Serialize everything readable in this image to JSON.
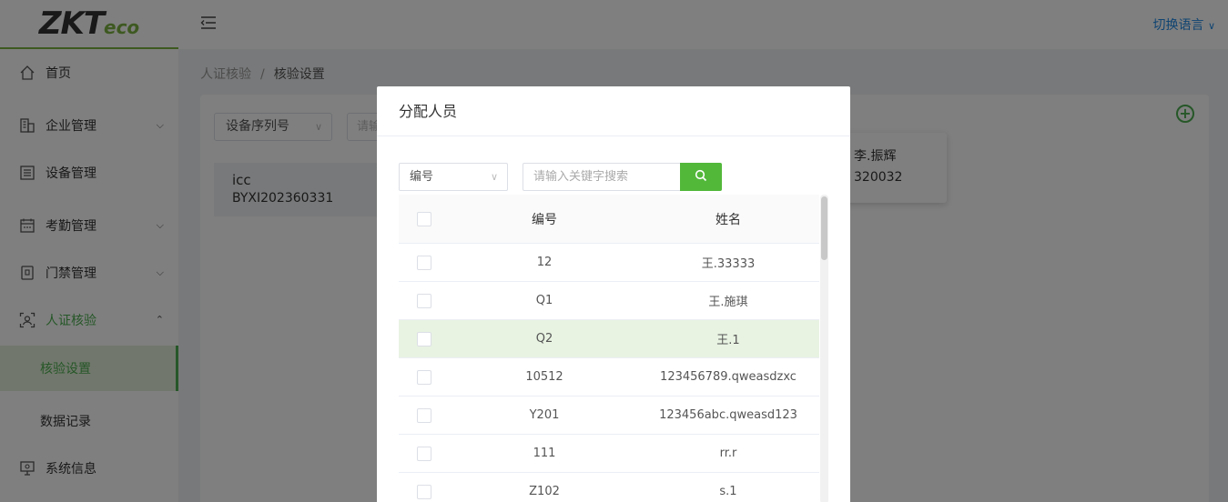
{
  "logo": {
    "main": "ZKT",
    "sub": "eco"
  },
  "header": {
    "language": "切换语言"
  },
  "sidebar": {
    "items": [
      {
        "label": "首页",
        "icon": "home-icon"
      },
      {
        "label": "企业管理",
        "icon": "building-icon"
      },
      {
        "label": "设备管理",
        "icon": "device-icon"
      },
      {
        "label": "考勤管理",
        "icon": "calendar-icon"
      },
      {
        "label": "门禁管理",
        "icon": "door-icon"
      },
      {
        "label": "人证核验",
        "icon": "face-scan-icon"
      },
      {
        "label": "系统信息",
        "icon": "monitor-icon"
      }
    ],
    "submenu": [
      {
        "label": "核验设置"
      },
      {
        "label": "数据记录"
      }
    ]
  },
  "breadcrumb": {
    "parent": "人证核验",
    "separator": "/",
    "current": "核验设置"
  },
  "filters": {
    "serial_select": "设备序列号",
    "keyword_placeholder": "请输"
  },
  "device_card": {
    "name": "icc",
    "serial": "BYXI202360331"
  },
  "person_card": {
    "name": "李.振辉",
    "code": "320032"
  },
  "modal": {
    "title": "分配人员",
    "filter_select": "编号",
    "search_placeholder": "请输入关键字搜索",
    "columns": {
      "code": "编号",
      "name": "姓名"
    },
    "rows": [
      {
        "code": "12",
        "name": "王.33333"
      },
      {
        "code": "Q1",
        "name": "王.施琪"
      },
      {
        "code": "Q2",
        "name": "王.1"
      },
      {
        "code": "10512",
        "name": "123456789.qweasdzxc"
      },
      {
        "code": "Y201",
        "name": "123456abc.qweasd123"
      },
      {
        "code": "111",
        "name": "rr.r"
      },
      {
        "code": "Z102",
        "name": "s.1"
      }
    ]
  },
  "colors": {
    "accent": "#4caf50",
    "search_button": "#52b83a",
    "link": "#1e88e5"
  }
}
